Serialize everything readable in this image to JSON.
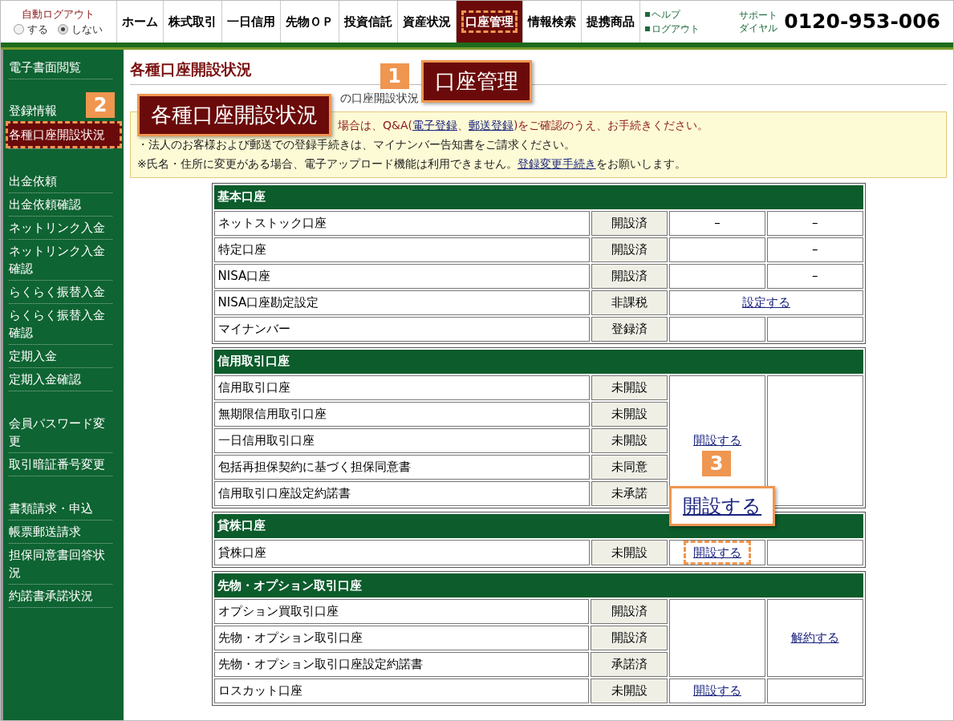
{
  "auto_logout": {
    "label": "自動ログアウト",
    "options": [
      {
        "label": "する",
        "selected": false
      },
      {
        "label": "しない",
        "selected": true
      }
    ]
  },
  "nav": {
    "items": [
      {
        "label": "ホーム",
        "selected": false
      },
      {
        "label": "株式取引",
        "selected": false
      },
      {
        "label": "一日信用",
        "selected": false
      },
      {
        "label": "先物ＯＰ",
        "selected": false
      },
      {
        "label": "投資信託",
        "selected": false
      },
      {
        "label": "資産状況",
        "selected": false
      },
      {
        "label": "口座管理",
        "selected": true,
        "annotation": {
          "kind": "below",
          "number": "1",
          "label": "口座管理"
        }
      },
      {
        "label": "情報検索",
        "selected": false
      },
      {
        "label": "提携商品",
        "selected": false
      }
    ]
  },
  "help_links": [
    "ヘルプ",
    "ログアウト"
  ],
  "support": {
    "label_line1": "サポート",
    "label_line2": "ダイヤル",
    "phone": "0120-953-006"
  },
  "sidebar": {
    "groups": [
      {
        "items": [
          {
            "kind": "link",
            "label": "電子書面閲覧",
            "selected": false
          }
        ]
      },
      {
        "items": [
          {
            "kind": "heading",
            "label": "登録情報"
          },
          {
            "kind": "link",
            "label": "各種口座開設状況",
            "selected": true,
            "annotation": {
              "kind": "right",
              "number": "2",
              "label": "各種口座開設状況"
            }
          }
        ]
      },
      {
        "items": [
          {
            "kind": "link",
            "label": "出金依頼",
            "selected": false
          },
          {
            "kind": "link",
            "label": "出金依頼確認",
            "selected": false
          },
          {
            "kind": "link",
            "label": "ネットリンク入金",
            "selected": false
          },
          {
            "kind": "link",
            "label": "ネットリンク入金確認",
            "selected": false
          },
          {
            "kind": "link",
            "label": "らくらく振替入金",
            "selected": false
          },
          {
            "kind": "link",
            "label": "らくらく振替入金確認",
            "selected": false
          },
          {
            "kind": "link",
            "label": "定期入金",
            "selected": false
          },
          {
            "kind": "link",
            "label": "定期入金確認",
            "selected": false
          }
        ]
      },
      {
        "items": [
          {
            "kind": "link",
            "label": "会員パスワード変更",
            "selected": false
          },
          {
            "kind": "link",
            "label": "取引暗証番号変更",
            "selected": false
          }
        ]
      },
      {
        "items": [
          {
            "kind": "link",
            "label": "書類請求・申込",
            "selected": false
          },
          {
            "kind": "link",
            "label": "帳票郵送請求",
            "selected": false
          },
          {
            "kind": "link",
            "label": "担保同意書回答状況",
            "selected": false
          },
          {
            "kind": "link",
            "label": "約諾書承諾状況",
            "selected": false
          }
        ]
      }
    ]
  },
  "page_title": "各種口座開設状況",
  "breadcrumb": "の口座開設状況",
  "notice": {
    "lines": [
      {
        "kind": "warning",
        "parts": [
          {
            "kind": "text",
            "text": "場合は、Q&A("
          },
          {
            "kind": "link",
            "text": "電子登録"
          },
          {
            "kind": "text",
            "text": "、"
          },
          {
            "kind": "link",
            "text": "郵送登録"
          },
          {
            "kind": "text",
            "text": ")をご確認のうえ、お手続きください。"
          }
        ]
      },
      {
        "kind": "normal",
        "parts": [
          {
            "kind": "text",
            "text": "・法人のお客様および郵送での登録手続きは、マイナンバー告知書をご請求ください。"
          }
        ]
      },
      {
        "kind": "normal",
        "parts": [
          {
            "kind": "text",
            "text": "※氏名・住所に変更がある場合、電子アップロード機能は利用できません。"
          },
          {
            "kind": "link",
            "text": "登録変更手続き"
          },
          {
            "kind": "text",
            "text": "をお願いします。"
          }
        ]
      }
    ]
  },
  "sections": [
    {
      "title": "基本口座",
      "rows": [
        {
          "name": "ネットストック口座",
          "status": "開設済",
          "extra": [
            {
              "kind": "text",
              "text": "–"
            },
            {
              "kind": "text",
              "text": "–"
            }
          ]
        },
        {
          "name": "特定口座",
          "status": "開設済",
          "extra": [
            {
              "kind": "empty"
            },
            {
              "kind": "text",
              "text": "–"
            }
          ]
        },
        {
          "name": "NISA口座",
          "status": "開設済",
          "extra": [
            {
              "kind": "empty"
            },
            {
              "kind": "text",
              "text": "–"
            }
          ]
        },
        {
          "name": "NISA口座勘定設定",
          "status": "非課税",
          "extra": [
            {
              "kind": "link",
              "text": "設定する"
            }
          ]
        },
        {
          "name": "マイナンバー",
          "status": "登録済",
          "extra": [
            {
              "kind": "empty"
            },
            {
              "kind": "empty"
            }
          ]
        }
      ]
    },
    {
      "title": "信用取引口座",
      "rows": [
        {
          "name": "信用取引口座",
          "status": "未開設",
          "extra": [
            {
              "kind": "link",
              "text": "開設する"
            },
            {
              "kind": "empty"
            }
          ]
        },
        {
          "name": "無期限信用取引口座",
          "status": "未開設",
          "extra": [
            {
              "kind": "covered"
            },
            {
              "kind": "covered"
            }
          ]
        },
        {
          "name": "一日信用取引口座",
          "status": "未開設",
          "extra": [
            {
              "kind": "covered"
            },
            {
              "kind": "covered"
            }
          ]
        },
        {
          "name": "包括再担保契約に基づく担保同意書",
          "status": "未同意",
          "extra": [
            {
              "kind": "covered"
            },
            {
              "kind": "covered"
            }
          ]
        },
        {
          "name": "信用取引口座設定約諾書",
          "status": "未承諾",
          "extra": [
            {
              "kind": "covered"
            },
            {
              "kind": "covered"
            }
          ]
        }
      ]
    },
    {
      "title": "貸株口座",
      "rows": [
        {
          "name": "貸株口座",
          "status": "未開設",
          "extra": [
            {
              "kind": "link",
              "text": "開設する",
              "annotation": {
                "kind": "above",
                "number": "3",
                "label": "開設する"
              }
            },
            {
              "kind": "empty"
            }
          ]
        }
      ]
    },
    {
      "title": "先物・オプション取引口座",
      "rows": [
        {
          "name": "オプション買取引口座",
          "status": "開設済",
          "extra": [
            {
              "kind": "empty"
            },
            {
              "kind": "link",
              "text": "解約する"
            }
          ]
        },
        {
          "name": "先物・オプション取引口座",
          "status": "開設済",
          "extra": [
            {
              "kind": "covered"
            },
            {
              "kind": "covered"
            }
          ]
        },
        {
          "name": "先物・オプション取引口座設定約諾書",
          "status": "承諾済",
          "extra": [
            {
              "kind": "covered"
            },
            {
              "kind": "covered"
            }
          ]
        },
        {
          "name": "ロスカット口座",
          "status": "未開設",
          "extra": [
            {
              "kind": "link",
              "text": "開設する"
            },
            {
              "kind": "empty"
            }
          ]
        }
      ]
    }
  ]
}
